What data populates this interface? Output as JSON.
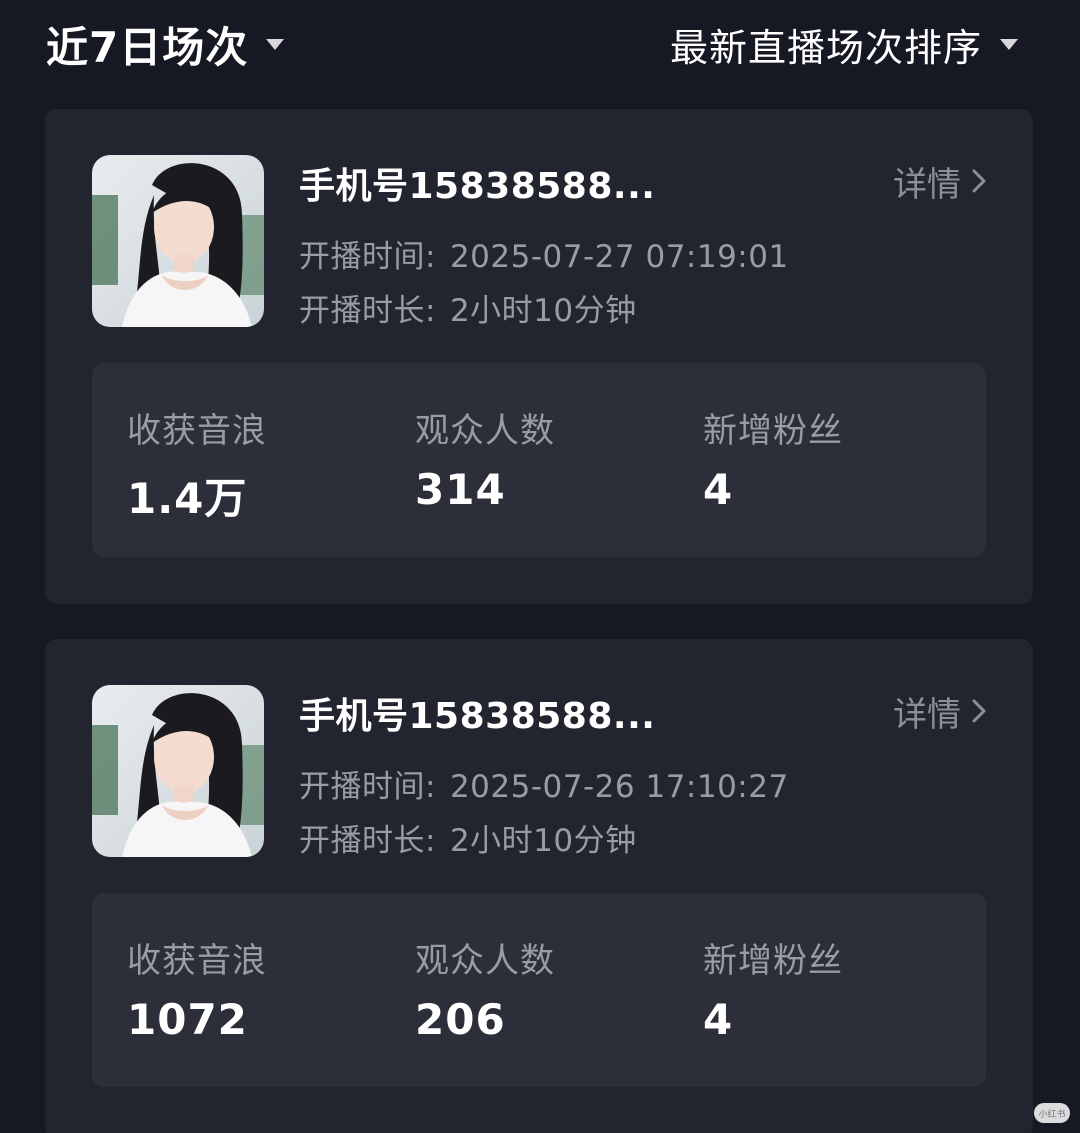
{
  "header": {
    "range_label": "近7日场次",
    "sort_label": "最新直播场次排序"
  },
  "sessions": [
    {
      "name": "手机号15838588...",
      "detail_label": "详情",
      "start_label": "开播时间:",
      "start_value": "2025-07-27 07:19:01",
      "duration_label": "开播时长:",
      "duration_value": "2小时10分钟",
      "stats": [
        {
          "label": "收获音浪",
          "value": "1.4万"
        },
        {
          "label": "观众人数",
          "value": "314"
        },
        {
          "label": "新增粉丝",
          "value": "4"
        }
      ]
    },
    {
      "name": "手机号15838588...",
      "detail_label": "详情",
      "start_label": "开播时间:",
      "start_value": "2025-07-26 17:10:27",
      "duration_label": "开播时长:",
      "duration_value": "2小时10分钟",
      "stats": [
        {
          "label": "收获音浪",
          "value": "1072"
        },
        {
          "label": "观众人数",
          "value": "206"
        },
        {
          "label": "新增粉丝",
          "value": "4"
        }
      ]
    }
  ],
  "watermark": "小红书"
}
